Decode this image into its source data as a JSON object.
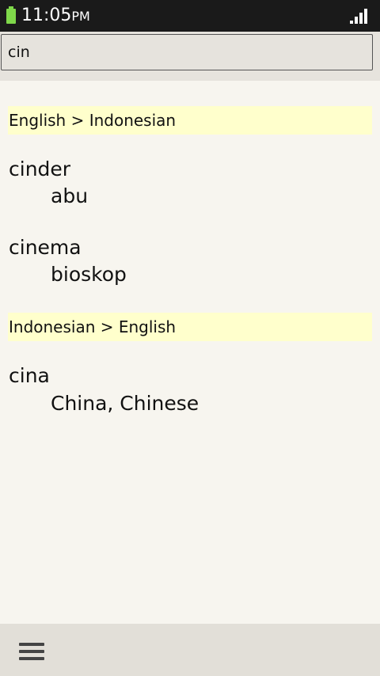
{
  "status_bar": {
    "time": "11:05",
    "ampm": "PM",
    "battery_color": "#7fd84a"
  },
  "search": {
    "value": "cin"
  },
  "results": {
    "sections": [
      {
        "header": "English > Indonesian",
        "entries": [
          {
            "word": "cinder",
            "translation": "abu"
          },
          {
            "word": "cinema",
            "translation": "bioskop"
          }
        ]
      },
      {
        "header": "Indonesian > English",
        "entries": [
          {
            "word": "cina",
            "translation": "China, Chinese"
          }
        ]
      }
    ]
  },
  "bottom_bar": {
    "menu_icon": "hamburger-menu-icon"
  },
  "colors": {
    "header_highlight": "#ffffcc",
    "background": "#f7f5ef"
  }
}
